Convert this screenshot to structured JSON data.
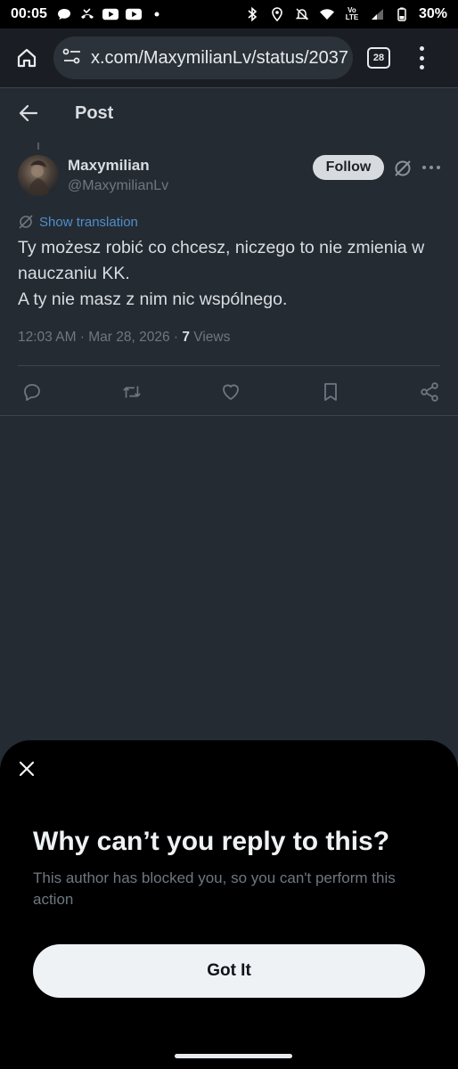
{
  "status_bar": {
    "time": "00:05",
    "battery": "30%",
    "network_label": "Vo LTE"
  },
  "browser": {
    "url": "x.com/MaxymilianLv/status/2037",
    "tab_count": "28"
  },
  "header": {
    "title": "Post"
  },
  "post": {
    "author_name": "Maxymilian",
    "author_handle": "@MaxymilianLv",
    "follow_label": "Follow",
    "translate_label": "Show translation",
    "body_lines": [
      "Ty możesz robić co chcesz, niczego to nie zmienia w nauczaniu KK.",
      "A ty nie masz z nim nic wspólnego."
    ],
    "timestamp": "12:03 AM · Mar 28, 2026 · ",
    "views_count": "7",
    "views_label": " Views"
  },
  "sheet": {
    "title": "Why can’t you reply to this?",
    "description": "This author has blocked you, so you can't perform this action",
    "button_label": "Got It"
  },
  "colors": {
    "background": "#252b33",
    "sheet_background": "#000000",
    "link_blue": "#4e8fcc",
    "muted_text": "#6e7780"
  }
}
